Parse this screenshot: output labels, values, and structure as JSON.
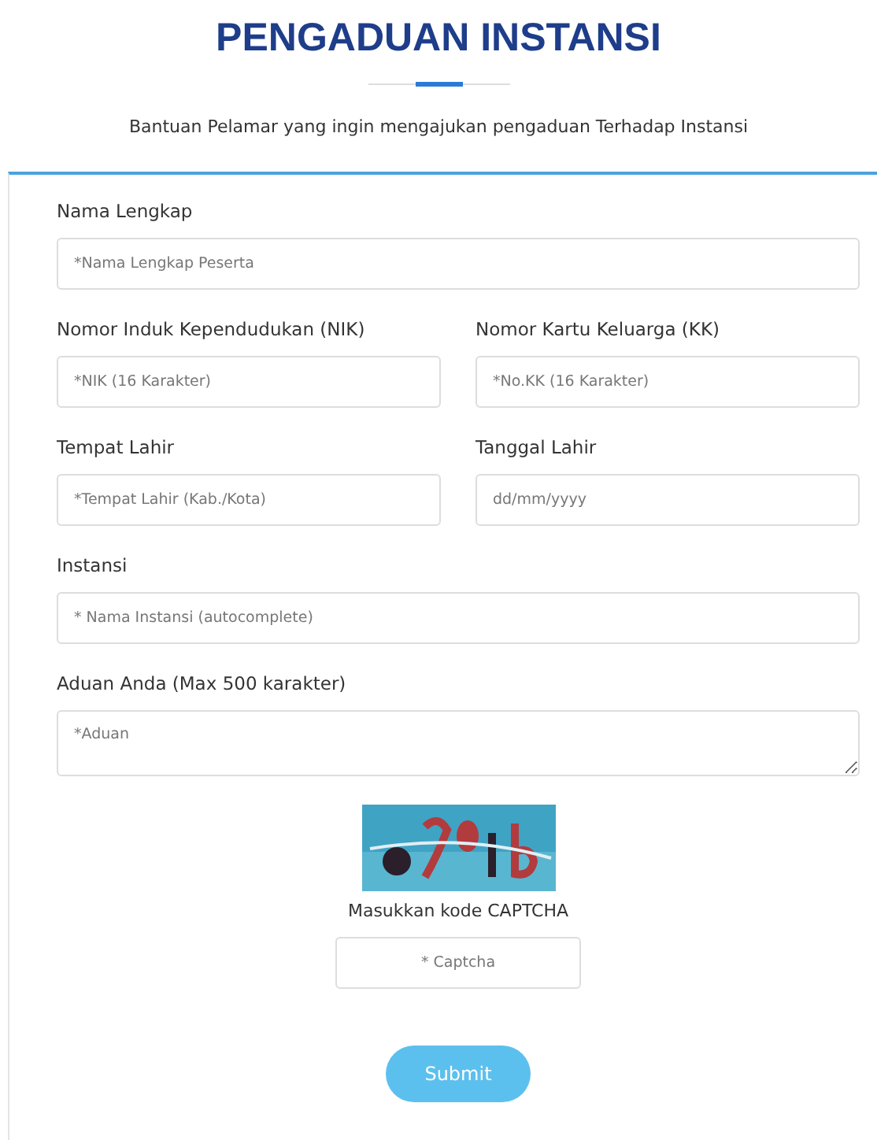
{
  "title": "PENGADUAN INSTANSI",
  "subtitle": "Bantuan Pelamar yang ingin mengajukan pengaduan Terhadap Instansi",
  "form": {
    "rows": [
      [
        {
          "kind": "input",
          "label": "Nama Lengkap",
          "placeholder": "*Nama Lengkap Peserta"
        }
      ],
      [
        {
          "kind": "input",
          "label": "Nomor Induk Kependudukan (NIK)",
          "placeholder": "*NIK (16 Karakter)"
        },
        {
          "kind": "input",
          "label": "Nomor Kartu Keluarga (KK)",
          "placeholder": "*No.KK (16 Karakter)"
        }
      ],
      [
        {
          "kind": "input",
          "label": "Tempat Lahir",
          "placeholder": "*Tempat Lahir (Kab./Kota)"
        },
        {
          "kind": "input",
          "label": "Tanggal Lahir",
          "placeholder": "dd/mm/yyyy"
        }
      ],
      [
        {
          "kind": "input",
          "label": "Instansi",
          "placeholder": "* Nama Instansi (autocomplete)"
        }
      ],
      [
        {
          "kind": "textarea",
          "label": "Aduan Anda (Max 500 karakter)",
          "placeholder": "*Aduan"
        }
      ]
    ],
    "captcha": {
      "label": "Masukkan kode CAPTCHA",
      "placeholder": "* Captcha"
    },
    "submit": "Submit"
  }
}
